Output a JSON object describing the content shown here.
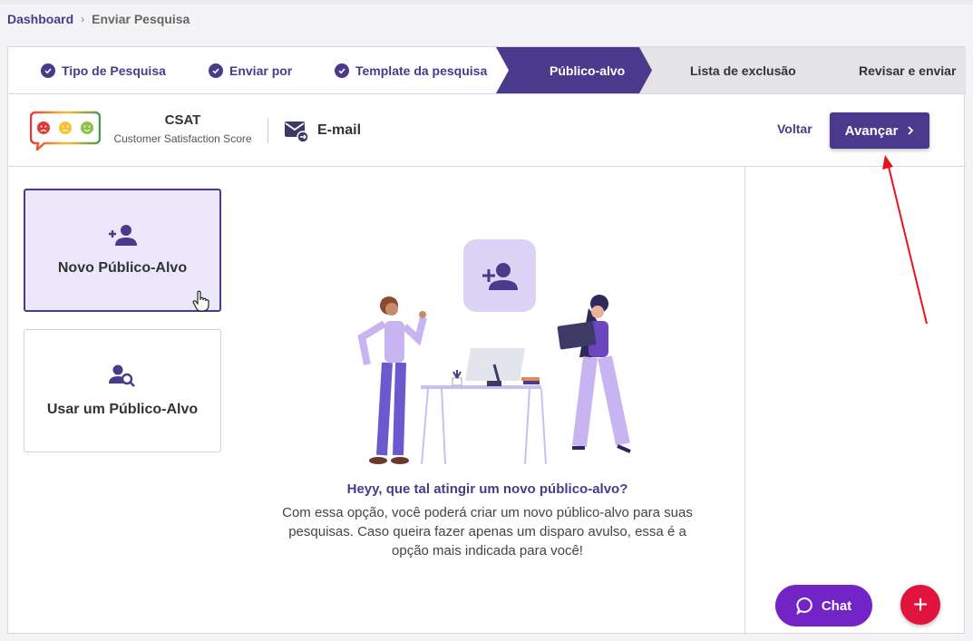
{
  "breadcrumb": {
    "home": "Dashboard",
    "current": "Enviar Pesquisa"
  },
  "stepper": {
    "steps": [
      {
        "label": "Tipo de Pesquisa",
        "state": "done"
      },
      {
        "label": "Enviar por",
        "state": "done"
      },
      {
        "label": "Template da pesquisa",
        "state": "done"
      },
      {
        "label": "Público-alvo",
        "state": "active"
      },
      {
        "label": "Lista de exclusão",
        "state": "pending"
      },
      {
        "label": "Revisar e enviar",
        "state": "pending"
      }
    ]
  },
  "header": {
    "survey_type": "CSAT",
    "survey_type_desc": "Customer Satisfaction Score",
    "channel": "E-mail",
    "back_label": "Voltar",
    "next_label": "Avançar"
  },
  "options": [
    {
      "label": "Novo Público-Alvo",
      "icon": "add-person-icon",
      "selected": true
    },
    {
      "label": "Usar um Público-Alvo",
      "icon": "search-person-icon",
      "selected": false
    }
  ],
  "message": {
    "title": "Heyy, que tal atingir um novo público-alvo?",
    "body": "Com essa opção, você poderá criar um novo público-alvo para suas pesquisas. Caso queira fazer apenas um disparo avulso, essa é a opção mais indicada para você!"
  },
  "chat": {
    "label": "Chat"
  },
  "fab": {
    "label": "+"
  },
  "colors": {
    "primary": "#4b3a8c",
    "chat": "#7224c6",
    "fab": "#e0143c",
    "annotation": "#e8141b"
  }
}
